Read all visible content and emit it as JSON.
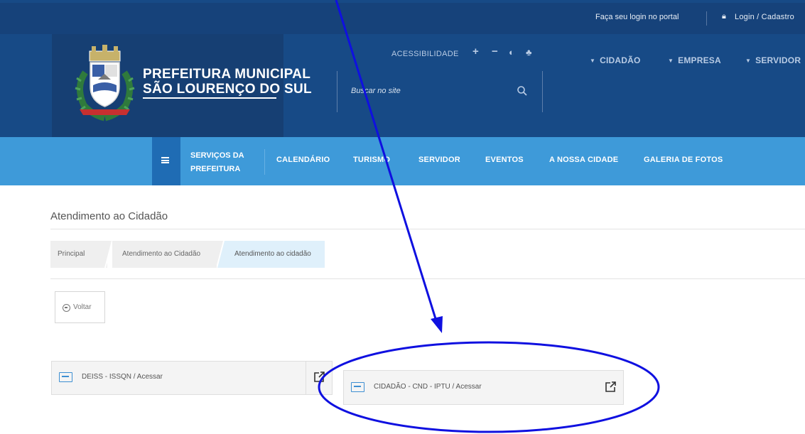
{
  "topbar": {
    "login_prompt": "Faça seu login no portal",
    "login_link": "Login / Cadastro"
  },
  "brand": {
    "line1": "PREFEITURA MUNICIPAL",
    "line2": "SÃO LOURENÇO DO SUL"
  },
  "accessibility": {
    "label": "ACESSIBILIDADE",
    "increase": "+",
    "decrease": "−",
    "contrast": "◐",
    "sitemap": "♣"
  },
  "search": {
    "placeholder": "Buscar no site"
  },
  "nav_top": [
    {
      "label": "CIDADÃO"
    },
    {
      "label": "EMPRESA"
    },
    {
      "label": "SERVIDOR"
    }
  ],
  "menu": {
    "services_line1": "SERVIÇOS DA",
    "services_line2": "PREFEITURA",
    "items": [
      {
        "label": "CALENDÁRIO"
      },
      {
        "label": "TURISMO"
      },
      {
        "label": "SERVIDOR"
      },
      {
        "label": "EVENTOS"
      },
      {
        "label": "A NOSSA CIDADE"
      },
      {
        "label": "GALERIA DE FOTOS"
      }
    ]
  },
  "page": {
    "title": "Atendimento ao Cidadão",
    "breadcrumb": [
      {
        "label": "Principal"
      },
      {
        "label": "Atendimento ao Cidadão"
      },
      {
        "label": "Atendimento ao cidadão"
      }
    ],
    "back_label": "Voltar"
  },
  "cards": [
    {
      "label": "DEISS - ISSQN / Acessar",
      "icon": "system-icon"
    },
    {
      "label": "CIDADÃO - CND - IPTU / Acessar",
      "icon": "system-icon"
    }
  ],
  "colors": {
    "header_bg": "#174a86",
    "menu_bg": "#3e9ad9",
    "annotation": "#0f10e0"
  }
}
